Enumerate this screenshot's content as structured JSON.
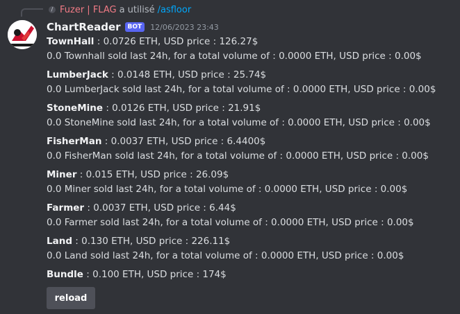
{
  "reply": {
    "user": "Fuzer | FLAG",
    "text": "a utilisé",
    "command": "/asfloor"
  },
  "message": {
    "author": "ChartReader",
    "badge": "BOT",
    "timestamp": "12/06/2023 23:43"
  },
  "items": [
    {
      "name": "TownHall",
      "price_line": " : 0.0726 ETH, USD price : 126.27$",
      "volume_line": "0.0 Townhall sold last 24h, for a total volume of : 0.0000 ETH, USD price : 0.00$"
    },
    {
      "name": "LumberJack",
      "price_line": " : 0.0148 ETH, USD price : 25.74$",
      "volume_line": "0.0 LumberJack sold last 24h, for a total volume of : 0.0000 ETH, USD price : 0.00$"
    },
    {
      "name": "StoneMine",
      "price_line": " : 0.0126 ETH, USD price : 21.91$",
      "volume_line": "0.0 StoneMine sold last 24h, for a total volume of : 0.0000 ETH, USD price : 0.00$"
    },
    {
      "name": "FisherMan",
      "price_line": " : 0.0037 ETH, USD price : 6.4400$",
      "volume_line": "0.0 FisherMan sold last 24h, for a total volume of : 0.0000 ETH, USD price : 0.00$"
    },
    {
      "name": "Miner",
      "price_line": " : 0.015 ETH, USD price : 26.09$",
      "volume_line": "0.0 Miner sold last 24h, for a total volume of : 0.0000 ETH, USD price : 0.00$"
    },
    {
      "name": "Farmer",
      "price_line": " : 0.0037 ETH, USD price : 6.44$",
      "volume_line": "0.0 Farmer sold last 24h, for a total volume of : 0.0000 ETH, USD price : 0.00$"
    },
    {
      "name": "Land",
      "price_line": " : 0.130 ETH, USD price : 226.11$",
      "volume_line": "0.0 Land sold last 24h, for a total volume of : 0.0000 ETH, USD price : 0.00$"
    },
    {
      "name": "Bundle",
      "price_line": " : 0.100 ETH, USD price : 174$",
      "volume_line": ""
    }
  ],
  "button": {
    "label": "reload"
  },
  "colors": {
    "background": "#313338",
    "reply_user": "#f27b86",
    "command": "#00a8fc",
    "bot_badge": "#5865f2",
    "button": "#4e5058"
  }
}
